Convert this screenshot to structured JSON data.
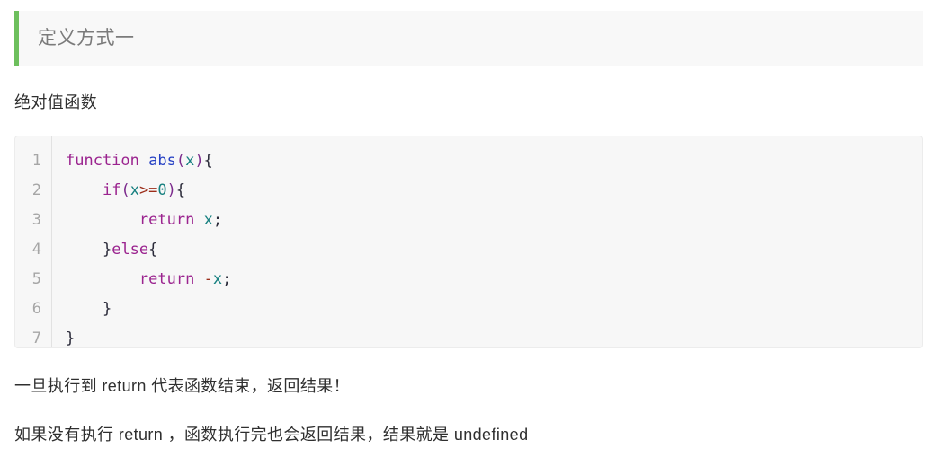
{
  "blockquote": {
    "text": "定义方式一",
    "accent_color": "#6dbf5d",
    "background_color": "#f8f8f8",
    "text_color": "#7b7b7b"
  },
  "intro_paragraph": "绝对值函数",
  "code_block": {
    "language": "javascript",
    "background_color": "#f7f7f7",
    "border_color": "#ececec",
    "line_numbers": [
      "1",
      "2",
      "3",
      "4",
      "5",
      "6",
      "7"
    ],
    "lines": [
      {
        "number": "1",
        "plain": "function abs(x){",
        "tokens": [
          {
            "text": "function",
            "kind": "keyword"
          },
          {
            "text": " ",
            "kind": "plain"
          },
          {
            "text": "abs",
            "kind": "function"
          },
          {
            "text": "(",
            "kind": "punct"
          },
          {
            "text": "x",
            "kind": "variable"
          },
          {
            "text": ")",
            "kind": "punct"
          },
          {
            "text": "{",
            "kind": "brace"
          }
        ]
      },
      {
        "number": "2",
        "plain": "    if(x>=0){",
        "tokens": [
          {
            "text": "    ",
            "kind": "plain"
          },
          {
            "text": "if",
            "kind": "keyword"
          },
          {
            "text": "(",
            "kind": "punct"
          },
          {
            "text": "x",
            "kind": "variable"
          },
          {
            "text": ">=",
            "kind": "operator"
          },
          {
            "text": "0",
            "kind": "number"
          },
          {
            "text": ")",
            "kind": "punct"
          },
          {
            "text": "{",
            "kind": "brace"
          }
        ]
      },
      {
        "number": "3",
        "plain": "        return x;",
        "tokens": [
          {
            "text": "        ",
            "kind": "plain"
          },
          {
            "text": "return",
            "kind": "keyword"
          },
          {
            "text": " ",
            "kind": "plain"
          },
          {
            "text": "x",
            "kind": "variable"
          },
          {
            "text": ";",
            "kind": "semicolon"
          }
        ]
      },
      {
        "number": "4",
        "plain": "    }else{",
        "tokens": [
          {
            "text": "    ",
            "kind": "plain"
          },
          {
            "text": "}",
            "kind": "brace"
          },
          {
            "text": "else",
            "kind": "keyword"
          },
          {
            "text": "{",
            "kind": "brace"
          }
        ]
      },
      {
        "number": "5",
        "plain": "        return -x;",
        "tokens": [
          {
            "text": "        ",
            "kind": "plain"
          },
          {
            "text": "return",
            "kind": "keyword"
          },
          {
            "text": " ",
            "kind": "plain"
          },
          {
            "text": "-",
            "kind": "operator"
          },
          {
            "text": "x",
            "kind": "variable"
          },
          {
            "text": ";",
            "kind": "semicolon"
          }
        ]
      },
      {
        "number": "6",
        "plain": "    }",
        "tokens": [
          {
            "text": "    ",
            "kind": "plain"
          },
          {
            "text": "}",
            "kind": "brace"
          }
        ]
      },
      {
        "number": "7",
        "plain": "}",
        "tokens": [
          {
            "text": "}",
            "kind": "brace"
          }
        ]
      }
    ]
  },
  "notes": {
    "note_1": "一旦执行到 return 代表函数结束，返回结果！",
    "note_2": "如果没有执行 return ，函数执行完也会返回结果，结果就是 undefined"
  }
}
